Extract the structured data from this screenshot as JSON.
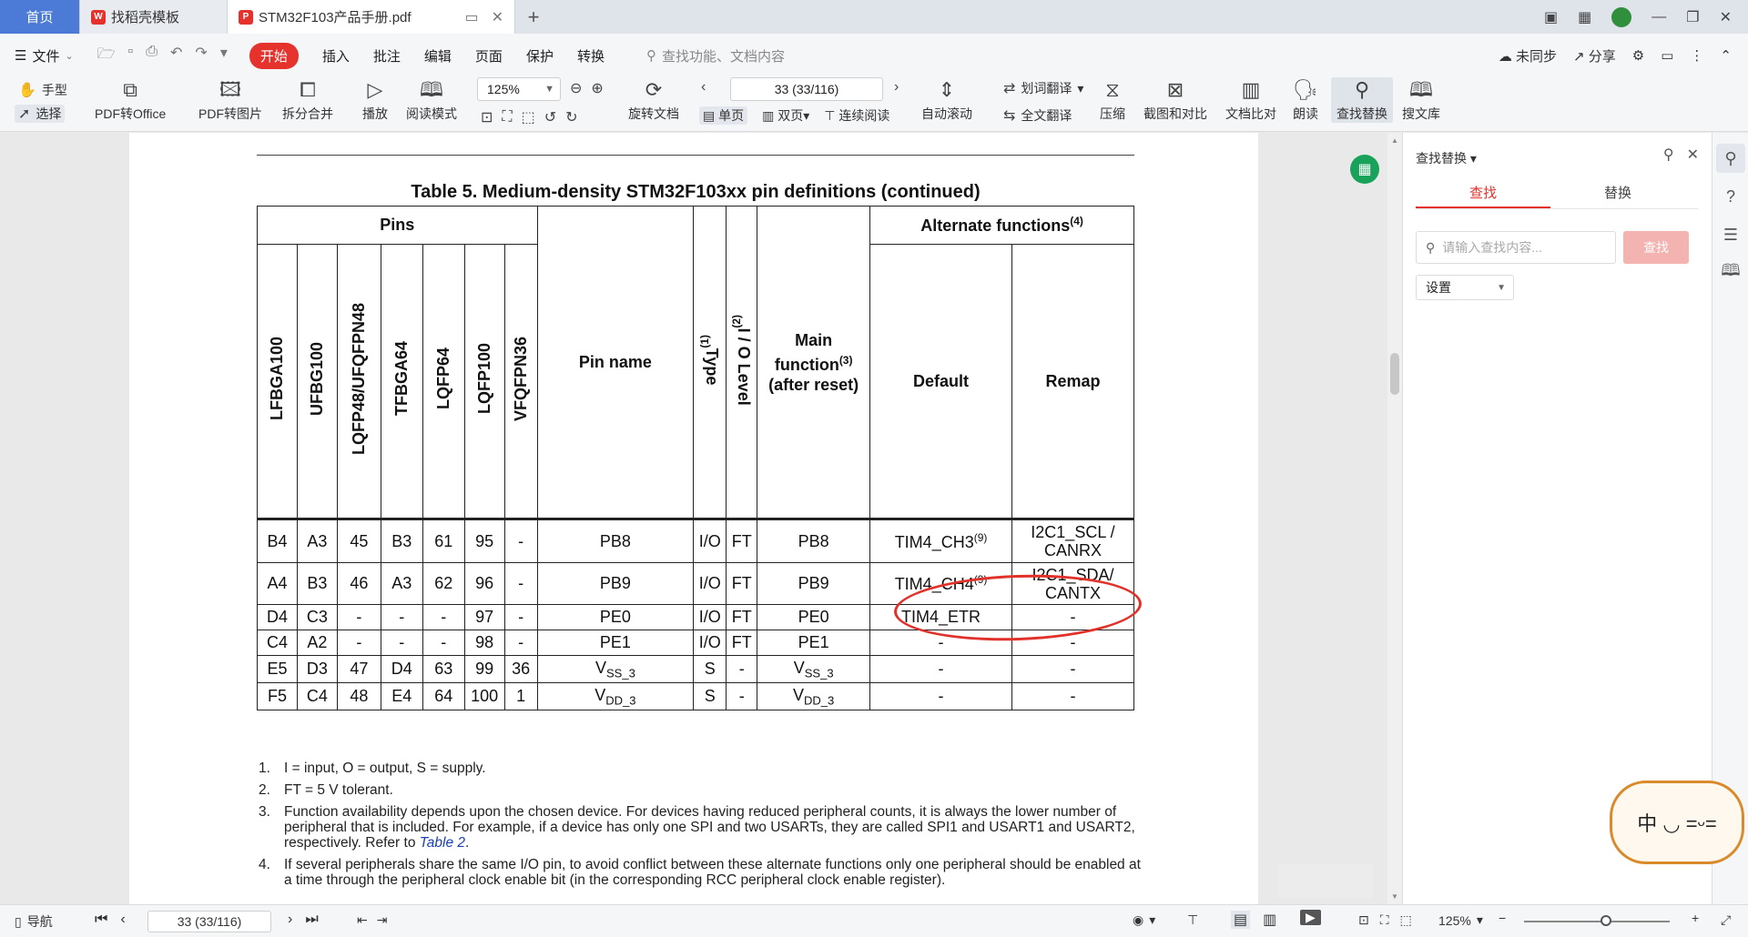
{
  "tabs": [
    {
      "label": "首页"
    },
    {
      "label": "找稻壳模板"
    },
    {
      "label": "STM32F103产品手册.pdf"
    }
  ],
  "menu": {
    "file": "文件",
    "start": "开始",
    "items": [
      "插入",
      "批注",
      "编辑",
      "页面",
      "保护",
      "转换"
    ],
    "search_placeholder": "查找功能、文档内容",
    "sync": "未同步",
    "share": "分享"
  },
  "ribbon": {
    "hand": "手型",
    "select": "选择",
    "pdf_to_office": "PDF转Office",
    "pdf_to_image": "PDF转图片",
    "split_merge": "拆分合并",
    "play": "播放",
    "read_mode": "阅读模式",
    "zoom": "125%",
    "rotate": "旋转文档",
    "page_value": "33 (33/116)",
    "single": "单页",
    "double": "双页",
    "continuous": "连续阅读",
    "autoscroll": "自动滚动",
    "word_translate": "划词翻译",
    "full_translate": "全文翻译",
    "compress": "压缩",
    "screenshot_compare": "截图和对比",
    "doc_compare": "文档比对",
    "read_aloud": "朗读",
    "find_replace": "查找替换",
    "search_lib": "搜文库"
  },
  "document": {
    "table_title": "Table 5. Medium-density STM32F103xx pin definitions (continued)",
    "headers": {
      "pins": "Pins",
      "pin_cols": [
        "LFBGA100",
        "UFBG100",
        "LQFP48/UFQFPN48",
        "TFBGA64",
        "LQFP64",
        "LQFP100",
        "VFQFPN36"
      ],
      "pin_name": "Pin name",
      "type": "Type",
      "type_sup": "(1)",
      "io_level": "I / O Level",
      "io_sup": "(2)",
      "main_func_1": "Main",
      "main_func_2": "function",
      "main_func_sup": "(3)",
      "main_func_3": "(after reset)",
      "alt": "Alternate functions",
      "alt_sup": "(4)",
      "default": "Default",
      "remap": "Remap"
    },
    "rows": [
      {
        "c": [
          "B4",
          "A3",
          "45",
          "B3",
          "61",
          "95",
          "-"
        ],
        "name": "PB8",
        "type": "I/O",
        "io": "FT",
        "main": "PB8",
        "def": "TIM4_CH3",
        "def_sup": "(9)",
        "remap1": "I2C1_SCL /",
        "remap2": "CANRX"
      },
      {
        "c": [
          "A4",
          "B3",
          "46",
          "A3",
          "62",
          "96",
          "-"
        ],
        "name": "PB9",
        "type": "I/O",
        "io": "FT",
        "main": "PB9",
        "def": "TIM4_CH4",
        "def_sup": "(9)",
        "remap1": "I2C1_SDA/",
        "remap2": "CANTX"
      },
      {
        "c": [
          "D4",
          "C3",
          "-",
          "-",
          "-",
          "97",
          "-"
        ],
        "name": "PE0",
        "type": "I/O",
        "io": "FT",
        "main": "PE0",
        "def": "TIM4_ETR",
        "def_sup": "",
        "remap1": "-",
        "remap2": ""
      },
      {
        "c": [
          "C4",
          "A2",
          "-",
          "-",
          "-",
          "98",
          "-"
        ],
        "name": "PE1",
        "type": "I/O",
        "io": "FT",
        "main": "PE1",
        "def": "-",
        "def_sup": "",
        "remap1": "-",
        "remap2": ""
      },
      {
        "c": [
          "E5",
          "D3",
          "47",
          "D4",
          "63",
          "99",
          "36"
        ],
        "name": "V",
        "name_sub": "SS_3",
        "type": "S",
        "io": "-",
        "main": "V",
        "main_sub": "SS_3",
        "def": "-",
        "def_sup": "",
        "remap1": "-",
        "remap2": ""
      },
      {
        "c": [
          "F5",
          "C4",
          "48",
          "E4",
          "64",
          "100",
          "1"
        ],
        "name": "V",
        "name_sub": "DD_3",
        "type": "S",
        "io": "-",
        "main": "V",
        "main_sub": "DD_3",
        "def": "-",
        "def_sup": "",
        "remap1": "-",
        "remap2": ""
      }
    ],
    "notes": [
      {
        "n": "1.",
        "text": "I = input, O = output, S = supply."
      },
      {
        "n": "2.",
        "text": "FT = 5 V tolerant."
      },
      {
        "n": "3.",
        "text": "Function availability depends upon the chosen device. For devices having reduced peripheral counts, it is always the lower number of peripheral that is included. For example, if a device has only one SPI and two USARTs, they are called SPI1 and USART1 and USART2, respectively. Refer to ",
        "link": "Table 2",
        "after": "."
      },
      {
        "n": "4.",
        "text": "If several peripherals share the same I/O pin, to avoid conflict between these alternate functions only one peripheral should be enabled at a time through the peripheral clock enable bit (in the corresponding RCC peripheral clock enable register)."
      }
    ]
  },
  "panel": {
    "title": "查找替换",
    "tab_find": "查找",
    "tab_replace": "替换",
    "input_placeholder": "请输入查找内容...",
    "find_button": "查找",
    "settings": "设置"
  },
  "status": {
    "nav": "导航",
    "page_value": "33 (33/116)",
    "zoom": "125%"
  }
}
